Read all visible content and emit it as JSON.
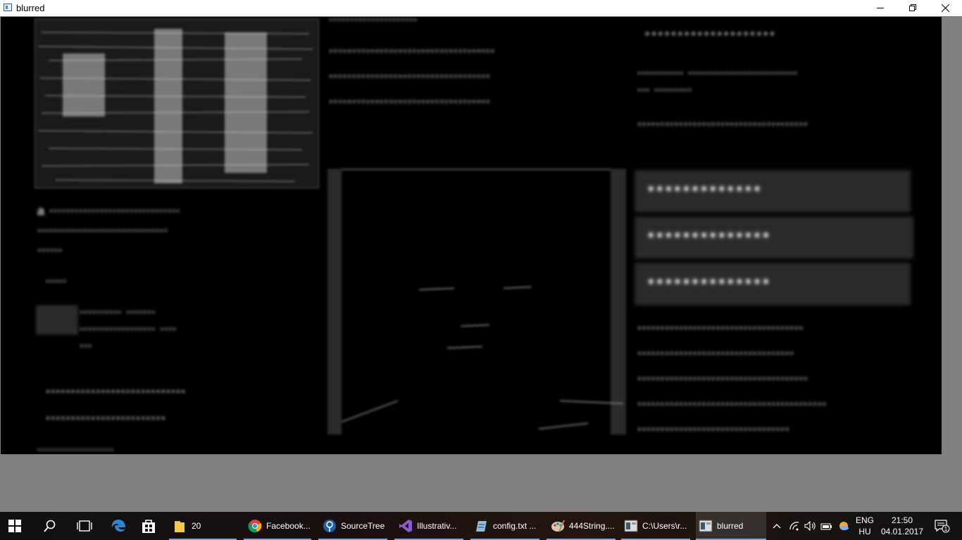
{
  "window": {
    "title": "blurred",
    "icon": "app-window-icon",
    "controls": [
      "minimize-icon",
      "restore-icon",
      "close-icon"
    ]
  },
  "content": {
    "description": "blurred newspaper-style page",
    "colors": {
      "background": "#000000",
      "text": "#d0d0d0",
      "frame": "#808080"
    }
  },
  "taskbar": {
    "start_icon": "windows-start-icon",
    "search_icon": "search-icon",
    "task_view_icon": "task-view-icon",
    "pinned": [
      {
        "icon": "edge-icon"
      },
      {
        "icon": "store-icon"
      }
    ],
    "items": [
      {
        "icon": "folder-icon",
        "label": "20"
      },
      {
        "icon": "chrome-icon",
        "label": "Facebook..."
      },
      {
        "icon": "sourcetree-icon",
        "label": "SourceTree"
      },
      {
        "icon": "visual-studio-icon",
        "label": "Illustrativ..."
      },
      {
        "icon": "notepad-icon",
        "label": "config.txt ..."
      },
      {
        "icon": "paint-icon",
        "label": "444String...."
      },
      {
        "icon": "console-icon",
        "label": "C:\\Users\\r..."
      },
      {
        "icon": "app-window-icon",
        "label": "blurred"
      }
    ],
    "tray": {
      "icons": [
        "chevron-up-icon",
        "wifi-icon",
        "volume-icon",
        "battery-icon",
        "weather-icon"
      ],
      "lang_top": "ENG",
      "lang_bottom": "HU",
      "time": "21:50",
      "date": "04.01.2017",
      "notification_count": "1"
    }
  }
}
